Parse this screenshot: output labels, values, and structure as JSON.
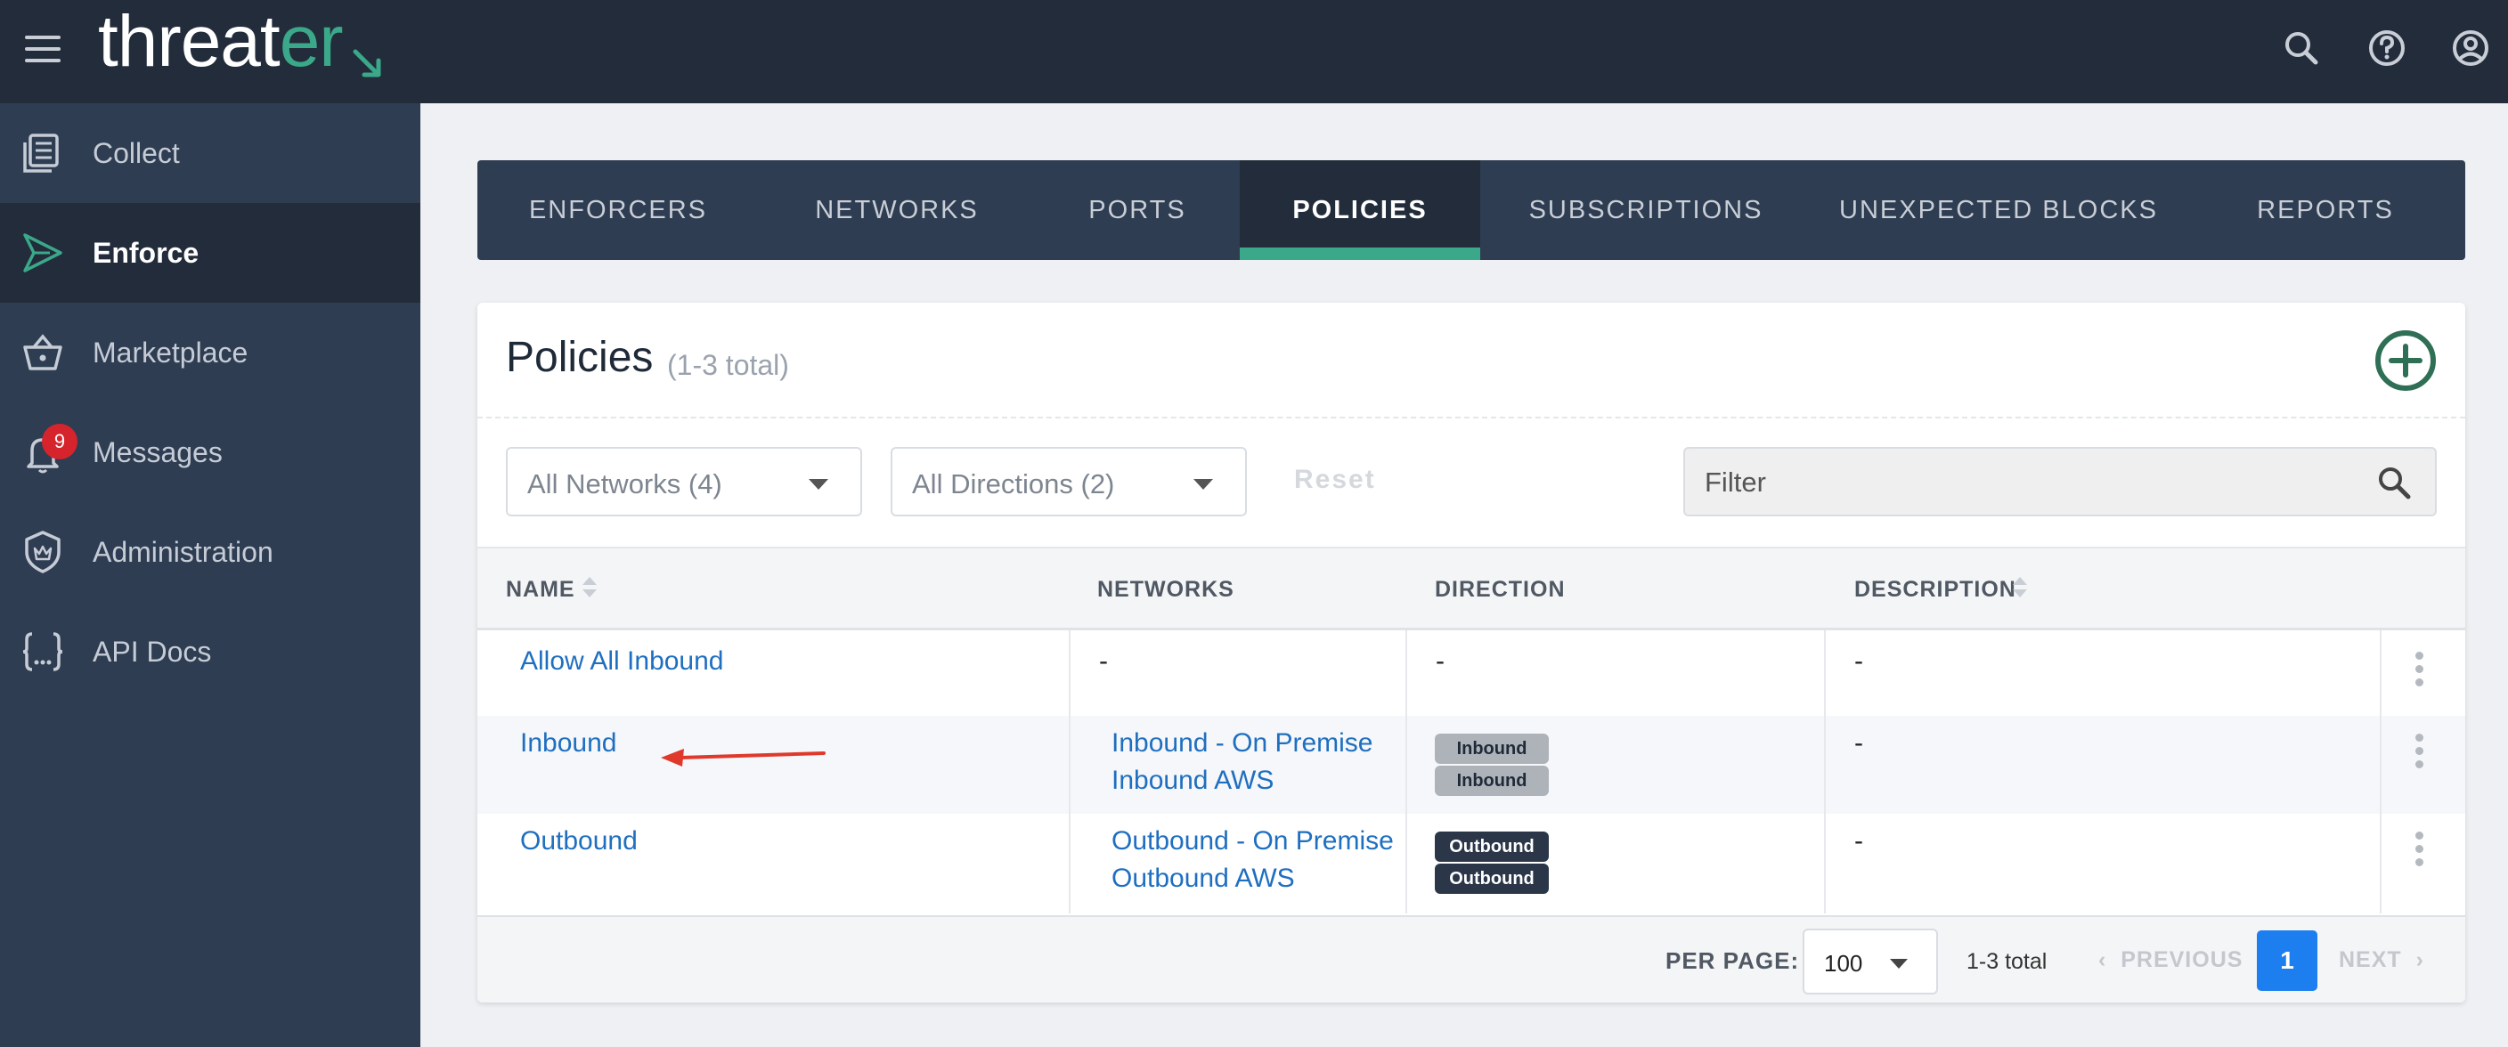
{
  "app": {
    "logo_text_main": "threat",
    "logo_text_accent": "er"
  },
  "topbar": {
    "icons": [
      "menu-icon",
      "search-icon",
      "help-icon",
      "account-icon"
    ]
  },
  "sidebar": {
    "items": [
      {
        "label": "Collect",
        "icon": "collect-icon",
        "active": false
      },
      {
        "label": "Enforce",
        "icon": "enforce-icon",
        "active": true
      },
      {
        "label": "Marketplace",
        "icon": "basket-icon",
        "active": false
      },
      {
        "label": "Messages",
        "icon": "bell-icon",
        "active": false,
        "badge": "9"
      },
      {
        "label": "Administration",
        "icon": "shield-icon",
        "active": false
      },
      {
        "label": "API Docs",
        "icon": "braces-icon",
        "active": false
      }
    ]
  },
  "tabs": [
    {
      "label": "ENFORCERS"
    },
    {
      "label": "NETWORKS"
    },
    {
      "label": "PORTS"
    },
    {
      "label": "POLICIES",
      "active": true
    },
    {
      "label": "SUBSCRIPTIONS"
    },
    {
      "label": "UNEXPECTED BLOCKS"
    },
    {
      "label": "REPORTS"
    }
  ],
  "card": {
    "title": "Policies",
    "count": "(1-3 total)",
    "filters": {
      "networks": "All Networks (4)",
      "directions": "All Directions (2)",
      "reset": "Reset",
      "filter_placeholder": "Filter"
    }
  },
  "table": {
    "headers": {
      "name": "NAME",
      "networks": "NETWORKS",
      "direction": "DIRECTION",
      "description": "DESCRIPTION"
    },
    "rows": [
      {
        "name": "Allow All Inbound",
        "networks": [
          "-"
        ],
        "direction": [
          "-"
        ],
        "description": "-"
      },
      {
        "name": "Inbound",
        "networks": [
          "Inbound - On Premise",
          "Inbound AWS"
        ],
        "direction": [
          "Inbound",
          "Inbound"
        ],
        "description": "-"
      },
      {
        "name": "Outbound",
        "networks": [
          "Outbound - On Premise",
          "Outbound AWS"
        ],
        "direction": [
          "Outbound",
          "Outbound"
        ],
        "description": "-"
      }
    ]
  },
  "pagination": {
    "per_page_label": "PER PAGE:",
    "per_page_value": "100",
    "total": "1-3 total",
    "previous": "PREVIOUS",
    "current_page": "1",
    "next": "NEXT"
  },
  "colors": {
    "accent": "#3aa889",
    "topbar": "#222c3b",
    "sidebar": "#2e3d52",
    "link": "#1f6fc0",
    "primary_button": "#1d7ef0",
    "badge": "#d6242d",
    "annotation_arrow": "#e0392b"
  }
}
